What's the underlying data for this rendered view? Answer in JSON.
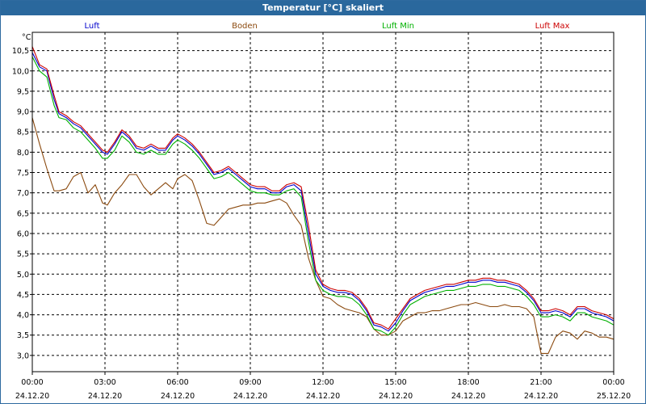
{
  "window": {
    "title": "Temperatur [°C] skaliert"
  },
  "chart_data": {
    "type": "line",
    "title": "Temperatur [°C] skaliert",
    "ylabel": "°C",
    "xlabel": "",
    "ylim": [
      2.6,
      10.95
    ],
    "xlim": [
      0,
      24
    ],
    "grid": true,
    "legend_position": "top",
    "y_ticks": [
      "3,0",
      "3,5",
      "4,0",
      "4,5",
      "5,0",
      "5,5",
      "6,0",
      "6,5",
      "7,0",
      "7,5",
      "8,0",
      "8,5",
      "9,0",
      "9,5",
      "10,0",
      "10,5"
    ],
    "y_tick_values": [
      3.0,
      3.5,
      4.0,
      4.5,
      5.0,
      5.5,
      6.0,
      6.5,
      7.0,
      7.5,
      8.0,
      8.5,
      9.0,
      9.5,
      10.0,
      10.5
    ],
    "x_ticks": [
      {
        "time": "00:00",
        "date": "24.12.20",
        "value": 0
      },
      {
        "time": "03:00",
        "date": "24.12.20",
        "value": 3
      },
      {
        "time": "06:00",
        "date": "24.12.20",
        "value": 6
      },
      {
        "time": "09:00",
        "date": "24.12.20",
        "value": 9
      },
      {
        "time": "12:00",
        "date": "24.12.20",
        "value": 12
      },
      {
        "time": "15:00",
        "date": "24.12.20",
        "value": 15
      },
      {
        "time": "18:00",
        "date": "24.12.20",
        "value": 18
      },
      {
        "time": "21:00",
        "date": "24.12.20",
        "value": 21
      },
      {
        "time": "00:00",
        "date": "25.12.20",
        "value": 24
      }
    ],
    "series": [
      {
        "name": "Luft",
        "color": "#0000cc",
        "x": [
          0,
          0.3,
          0.6,
          0.9,
          1.1,
          1.4,
          1.7,
          2.0,
          2.3,
          2.6,
          2.9,
          3.1,
          3.4,
          3.7,
          4.0,
          4.3,
          4.6,
          4.9,
          5.2,
          5.5,
          5.8,
          6.0,
          6.3,
          6.6,
          6.9,
          7.2,
          7.5,
          7.8,
          8.1,
          8.4,
          8.7,
          9.0,
          9.3,
          9.6,
          9.9,
          10.2,
          10.5,
          10.8,
          11.1,
          11.4,
          11.7,
          12.0,
          12.3,
          12.6,
          12.9,
          13.2,
          13.5,
          13.8,
          14.1,
          14.4,
          14.7,
          15.0,
          15.3,
          15.6,
          15.9,
          16.2,
          16.5,
          16.8,
          17.1,
          17.4,
          17.7,
          18.0,
          18.3,
          18.6,
          18.9,
          19.2,
          19.5,
          19.8,
          20.1,
          20.4,
          20.7,
          21.0,
          21.3,
          21.6,
          21.9,
          22.2,
          22.5,
          22.8,
          23.1,
          23.4,
          23.7,
          24.0
        ],
        "values": [
          10.45,
          10.1,
          10.0,
          9.3,
          8.95,
          8.85,
          8.7,
          8.6,
          8.4,
          8.2,
          8.0,
          7.95,
          8.2,
          8.5,
          8.35,
          8.1,
          8.05,
          8.15,
          8.05,
          8.05,
          8.3,
          8.4,
          8.3,
          8.15,
          7.95,
          7.7,
          7.45,
          7.5,
          7.6,
          7.45,
          7.3,
          7.15,
          7.1,
          7.1,
          7.0,
          7.0,
          7.15,
          7.2,
          7.05,
          6.0,
          5.0,
          4.7,
          4.6,
          4.55,
          4.55,
          4.5,
          4.35,
          4.1,
          3.75,
          3.7,
          3.6,
          3.8,
          4.1,
          4.35,
          4.45,
          4.55,
          4.6,
          4.65,
          4.7,
          4.7,
          4.75,
          4.8,
          4.8,
          4.85,
          4.85,
          4.8,
          4.8,
          4.75,
          4.7,
          4.55,
          4.35,
          4.05,
          4.05,
          4.1,
          4.05,
          3.95,
          4.15,
          4.15,
          4.05,
          4.0,
          3.95,
          3.85
        ]
      },
      {
        "name": "Boden",
        "color": "#8b4a0f",
        "x": [
          0,
          0.3,
          0.6,
          0.9,
          1.1,
          1.4,
          1.7,
          2.0,
          2.3,
          2.6,
          2.9,
          3.1,
          3.4,
          3.7,
          4.0,
          4.3,
          4.6,
          4.9,
          5.2,
          5.5,
          5.8,
          6.0,
          6.3,
          6.6,
          6.9,
          7.2,
          7.5,
          7.8,
          8.1,
          8.4,
          8.7,
          9.0,
          9.3,
          9.6,
          9.9,
          10.2,
          10.5,
          10.8,
          11.1,
          11.4,
          11.7,
          12.0,
          12.3,
          12.6,
          12.9,
          13.2,
          13.5,
          13.8,
          14.1,
          14.4,
          14.7,
          15.0,
          15.3,
          15.6,
          15.9,
          16.2,
          16.5,
          16.8,
          17.1,
          17.4,
          17.7,
          18.0,
          18.3,
          18.6,
          18.9,
          19.2,
          19.5,
          19.8,
          20.1,
          20.4,
          20.7,
          21.0,
          21.3,
          21.6,
          21.9,
          22.2,
          22.5,
          22.8,
          23.1,
          23.4,
          23.7,
          24.0
        ],
        "values": [
          8.85,
          8.2,
          7.6,
          7.05,
          7.05,
          7.1,
          7.4,
          7.5,
          7.0,
          7.2,
          6.75,
          6.7,
          7.0,
          7.2,
          7.45,
          7.45,
          7.15,
          6.95,
          7.1,
          7.25,
          7.1,
          7.35,
          7.45,
          7.3,
          6.8,
          6.25,
          6.2,
          6.4,
          6.6,
          6.65,
          6.7,
          6.7,
          6.75,
          6.75,
          6.8,
          6.85,
          6.75,
          6.45,
          6.2,
          5.4,
          4.85,
          4.45,
          4.4,
          4.25,
          4.15,
          4.1,
          4.05,
          3.95,
          3.65,
          3.5,
          3.5,
          3.6,
          3.85,
          3.95,
          4.05,
          4.05,
          4.1,
          4.1,
          4.15,
          4.2,
          4.25,
          4.25,
          4.3,
          4.25,
          4.2,
          4.2,
          4.25,
          4.2,
          4.2,
          4.15,
          3.95,
          3.05,
          3.05,
          3.45,
          3.6,
          3.55,
          3.4,
          3.6,
          3.55,
          3.45,
          3.45,
          3.4
        ]
      },
      {
        "name": "Luft Min",
        "color": "#00b000",
        "x": [
          0,
          0.3,
          0.6,
          0.9,
          1.1,
          1.4,
          1.7,
          2.0,
          2.3,
          2.6,
          2.9,
          3.1,
          3.4,
          3.7,
          4.0,
          4.3,
          4.6,
          4.9,
          5.2,
          5.5,
          5.8,
          6.0,
          6.3,
          6.6,
          6.9,
          7.2,
          7.5,
          7.8,
          8.1,
          8.4,
          8.7,
          9.0,
          9.3,
          9.6,
          9.9,
          10.2,
          10.5,
          10.8,
          11.1,
          11.4,
          11.7,
          12.0,
          12.3,
          12.6,
          12.9,
          13.2,
          13.5,
          13.8,
          14.1,
          14.4,
          14.7,
          15.0,
          15.3,
          15.6,
          15.9,
          16.2,
          16.5,
          16.8,
          17.1,
          17.4,
          17.7,
          18.0,
          18.3,
          18.6,
          18.9,
          19.2,
          19.5,
          19.8,
          20.1,
          20.4,
          20.7,
          21.0,
          21.3,
          21.6,
          21.9,
          22.2,
          22.5,
          22.8,
          23.1,
          23.4,
          23.7,
          24.0
        ],
        "values": [
          10.35,
          10.0,
          9.85,
          9.15,
          8.85,
          8.8,
          8.6,
          8.5,
          8.3,
          8.1,
          7.85,
          7.85,
          8.05,
          8.4,
          8.25,
          8.0,
          7.95,
          8.05,
          7.95,
          7.95,
          8.2,
          8.3,
          8.2,
          8.05,
          7.85,
          7.6,
          7.35,
          7.4,
          7.5,
          7.35,
          7.2,
          7.05,
          7.0,
          7.0,
          6.95,
          6.95,
          7.05,
          7.1,
          6.9,
          5.8,
          4.85,
          4.6,
          4.5,
          4.45,
          4.45,
          4.4,
          4.25,
          4.0,
          3.65,
          3.6,
          3.5,
          3.7,
          4.0,
          4.25,
          4.35,
          4.45,
          4.5,
          4.55,
          4.6,
          4.6,
          4.65,
          4.7,
          4.7,
          4.75,
          4.75,
          4.7,
          4.7,
          4.65,
          4.6,
          4.45,
          4.25,
          3.95,
          3.95,
          4.0,
          3.95,
          3.85,
          4.05,
          4.05,
          3.95,
          3.9,
          3.85,
          3.75
        ]
      },
      {
        "name": "Luft Max",
        "color": "#cc0000",
        "x": [
          0,
          0.3,
          0.6,
          0.9,
          1.1,
          1.4,
          1.7,
          2.0,
          2.3,
          2.6,
          2.9,
          3.1,
          3.4,
          3.7,
          4.0,
          4.3,
          4.6,
          4.9,
          5.2,
          5.5,
          5.8,
          6.0,
          6.3,
          6.6,
          6.9,
          7.2,
          7.5,
          7.8,
          8.1,
          8.4,
          8.7,
          9.0,
          9.3,
          9.6,
          9.9,
          10.2,
          10.5,
          10.8,
          11.1,
          11.4,
          11.7,
          12.0,
          12.3,
          12.6,
          12.9,
          13.2,
          13.5,
          13.8,
          14.1,
          14.4,
          14.7,
          15.0,
          15.3,
          15.6,
          15.9,
          16.2,
          16.5,
          16.8,
          17.1,
          17.4,
          17.7,
          18.0,
          18.3,
          18.6,
          18.9,
          19.2,
          19.5,
          19.8,
          20.1,
          20.4,
          20.7,
          21.0,
          21.3,
          21.6,
          21.9,
          22.2,
          22.5,
          22.8,
          23.1,
          23.4,
          23.7,
          24.0
        ],
        "values": [
          10.6,
          10.15,
          10.05,
          9.4,
          9.0,
          8.9,
          8.75,
          8.65,
          8.45,
          8.25,
          8.05,
          8.0,
          8.25,
          8.55,
          8.4,
          8.15,
          8.1,
          8.2,
          8.1,
          8.1,
          8.35,
          8.45,
          8.35,
          8.2,
          8.0,
          7.75,
          7.5,
          7.55,
          7.65,
          7.5,
          7.35,
          7.2,
          7.15,
          7.15,
          7.05,
          7.05,
          7.2,
          7.25,
          7.15,
          6.2,
          5.1,
          4.75,
          4.65,
          4.6,
          4.6,
          4.55,
          4.4,
          4.15,
          3.8,
          3.75,
          3.65,
          3.9,
          4.15,
          4.4,
          4.5,
          4.6,
          4.65,
          4.7,
          4.75,
          4.75,
          4.8,
          4.85,
          4.85,
          4.9,
          4.9,
          4.85,
          4.85,
          4.8,
          4.75,
          4.6,
          4.4,
          4.1,
          4.1,
          4.15,
          4.1,
          4.0,
          4.2,
          4.2,
          4.1,
          4.05,
          4.0,
          3.9
        ]
      }
    ]
  }
}
